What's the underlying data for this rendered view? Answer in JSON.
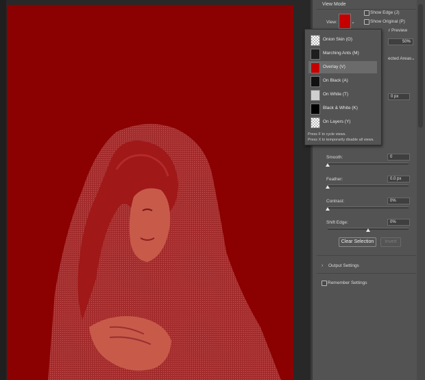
{
  "view_mode": {
    "section_title": "View Mode",
    "view_label": "View:",
    "show_edge": "Show Edge (J)",
    "show_original": "Show Original (P)",
    "preview_partial": "r Preview"
  },
  "partial_controls": {
    "opacity_value": "50%",
    "display_partial": "ected Areas",
    "radius_partial": "0 px"
  },
  "view_menu": {
    "items": [
      {
        "label": "Onion Skin (O)",
        "thumb": "checker"
      },
      {
        "label": "Marching Ants (M)",
        "thumb": "dark"
      },
      {
        "label": "Overlay (V)",
        "thumb": "red",
        "selected": true
      },
      {
        "label": "On Black (A)",
        "thumb": "dark"
      },
      {
        "label": "On White (T)",
        "thumb": "light"
      },
      {
        "label": "Black & White (K)",
        "thumb": "black"
      },
      {
        "label": "On Layers (Y)",
        "thumb": "checker"
      }
    ],
    "hint_1": "Press F to cycle views.",
    "hint_2": "Press X to temporarily disable all views."
  },
  "global_refinements": {
    "smooth_label": "Smooth:",
    "smooth_value": "0",
    "feather_label": "Feather:",
    "feather_value": "0.0 px",
    "contrast_label": "Contrast:",
    "contrast_value": "0%",
    "shift_edge_label": "Shift Edge:",
    "shift_edge_value": "0%",
    "smooth_level": 0,
    "feather_level": 0,
    "contrast_level": 0,
    "shift_edge_level": 0.5
  },
  "buttons": {
    "clear_selection": "Clear Selection",
    "invert": "Invert"
  },
  "output_settings": "Output Settings",
  "remember_settings": "Remember Settings",
  "colors": {
    "overlay_red": "#8b0000",
    "panel_bg": "#535353"
  }
}
